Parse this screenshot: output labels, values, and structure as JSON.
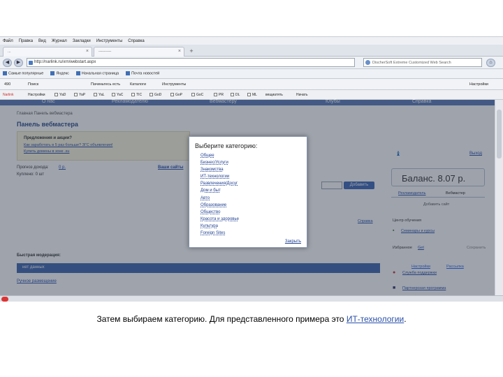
{
  "browser": {
    "menu": [
      "Файл",
      "Правка",
      "Вид",
      "Журнал",
      "Закладки",
      "Инструменты",
      "Справка"
    ],
    "tabs": [
      {
        "label": "..."
      },
      {
        "label": "----------"
      }
    ],
    "url": "http://narlink.ru/xrn/webstart.aspx",
    "search_placeholder": "DischerSoft Extreme Customized Web Search",
    "bookmarks": [
      "Самые популярные",
      "Яндекс",
      "Начальная страница",
      "Почта новостей"
    ],
    "toolbar": {
      "weather": "490",
      "search_label": "Поиск",
      "items": [
        "Пачиньтесь есть",
        "Каталоги",
        "Инструменты"
      ],
      "settings": "Настройки"
    },
    "toolbar2": {
      "brand": "Narlink",
      "settings": "Настройки",
      "checks": [
        "YaD",
        "YaP",
        "YaL",
        "YaC",
        "TIC",
        "GoD",
        "GoP",
        "GoC",
        "PR",
        "DL",
        "ML"
      ],
      "extra": [
        "вещиатять",
        "Начать"
      ]
    }
  },
  "site": {
    "nav": [
      "О нас",
      "Рекламодателю",
      "Вебмастеру",
      "Клубы",
      "Справка"
    ],
    "breadcrumb": "Главная  Панель вебмастера",
    "page_title": "Панель вебмастера",
    "promo_title": "Предложения и акции?",
    "promo_links": [
      "Как заработать в 5 раз больше? ЗГС объявления!",
      "Купить домены в зоне .su"
    ],
    "income_label": "Прогноз дохода:",
    "income_value": "0 р.",
    "bought_label": "Куплено: 0 шт",
    "all_sites": "Ваши сайты",
    "add_button": "Добавить",
    "quick_mod": "Быстрая модерация:",
    "no_data": "нет данных",
    "manual": "Ручное размещение",
    "balance": "Баланс. 8.07 р.",
    "exit": "Выход",
    "role_tabs": [
      "Рекламодатель",
      "Вебмастер"
    ],
    "add_site": "Добавить сайт",
    "help_link": "Справка",
    "training": "Центр обучения",
    "seminars": "Семинары и курсы",
    "favorites": "Избранное",
    "favorites_link": "Get",
    "save": "Сохранить",
    "support": "Служба поддержки",
    "partner": "Партнерская программа",
    "settings": "Настройки",
    "mailing": "Рассылка"
  },
  "dialog": {
    "title": "Выберите категорию:",
    "categories": [
      "Общее",
      "Бизнес/Услуги",
      "Знакомства",
      "ИТ-технологии",
      "Развлечения/Досуг",
      "Дом и быт",
      "Авто",
      "Образование",
      "Общество",
      "Красота и здоровье",
      "Культура",
      "Foreign Sites"
    ],
    "close": "Закрыть"
  },
  "caption": {
    "before": "Затем выбираем категорию. Для представленного примера это ",
    "highlight": "ИТ-технологии",
    "after": "."
  },
  "colors": {
    "site_nav": "#5b7bb8",
    "link": "#2a4fa8",
    "overlay": "rgba(40,50,70,0.45)"
  }
}
